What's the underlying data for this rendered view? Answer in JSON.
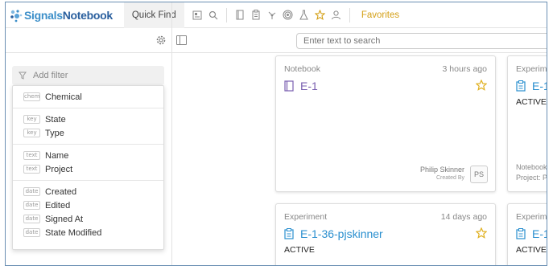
{
  "app": {
    "logo_part1": "Signals",
    "logo_part2": "Notebook",
    "quick_find": "Quick Find",
    "favorites": "Favorites",
    "search_placeholder": "Enter text to search"
  },
  "filter": {
    "add_filter": "Add filter",
    "groups": [
      [
        {
          "tag": "chem",
          "label": "Chemical"
        }
      ],
      [
        {
          "tag": "key",
          "label": "State"
        },
        {
          "tag": "key",
          "label": "Type"
        }
      ],
      [
        {
          "tag": "text",
          "label": "Name"
        },
        {
          "tag": "text",
          "label": "Project"
        }
      ],
      [
        {
          "tag": "date",
          "label": "Created"
        },
        {
          "tag": "date",
          "label": "Edited"
        },
        {
          "tag": "date",
          "label": "Signed At"
        },
        {
          "tag": "date",
          "label": "State Modified"
        }
      ]
    ]
  },
  "cards": [
    {
      "type": "Notebook",
      "time": "3 hours ago",
      "title": "E-1",
      "status": "",
      "owner": "Philip Skinner",
      "created_by": "Created By",
      "initials": "PS",
      "accent": "#7a5fb0"
    },
    {
      "type": "Experime",
      "time": "",
      "title": "E-1",
      "status": "ACTIVE",
      "meta1": "Notebook",
      "meta2": "Project: P",
      "accent": "#2a8fcf"
    },
    {
      "type": "Experiment",
      "time": "14 days ago",
      "title": "E-1-36-pjskinner",
      "status": "ACTIVE",
      "accent": "#2a8fcf"
    },
    {
      "type": "Experime",
      "time": "",
      "title": "E-1",
      "status": "ACTIVE",
      "accent": "#2a8fcf"
    }
  ],
  "colors": {
    "star": "#e0b020",
    "link": "#2a8fcf",
    "notebook": "#7a5fb0",
    "favorites": "#d4a017"
  }
}
